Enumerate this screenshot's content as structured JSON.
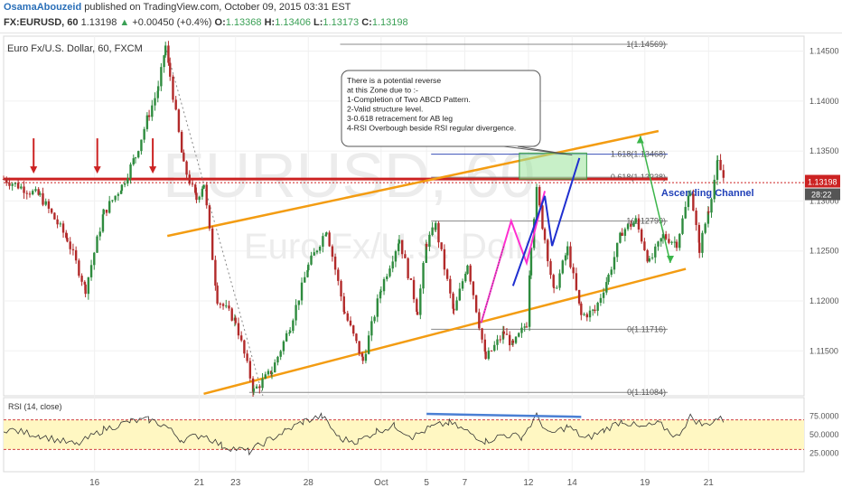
{
  "header": {
    "author": "OsamaAbouzeid",
    "published_text": "published on TradingView.com, October 09, 2015 03:31 EST",
    "symbol": "FX:EURUSD, 60",
    "last": "1.13198",
    "change_arrow": "▲",
    "change": "+0.00450 (+0.4%)",
    "open_label": "O:",
    "open": "1.13368",
    "high_label": "H:",
    "high": "1.13406",
    "low_label": "L:",
    "low": "1.13173",
    "close_label": "C:",
    "close": "1.13198"
  },
  "chart_title": "Euro Fx/U.S. Dollar, 60, FXCM",
  "watermark": {
    "symbol": "EURUSD, 60",
    "name": "Euro Fx/U.S. Dollar"
  },
  "colors": {
    "candle_up": "#2e8b3e",
    "candle_down": "#b22a2a",
    "channel": "#f39c12",
    "resistance": "#cc2222",
    "abcd_pink": "#ff2fd0",
    "abcd_blue": "#1f2fd0",
    "rsi_band": "#fff7c2",
    "rsi_div": "#4a7fd4",
    "fib": "#888888",
    "zone": "#9be39b",
    "green_arrow": "#3bb54a"
  },
  "annotation": {
    "lines": [
      "There is a potential reverse",
      "at this Zone due to   :-",
      "1-Completion of Two ABCD  Pattern.",
      "2-Valid structure level.",
      "3-0.618  retracement for AB leg",
      "4-RSI Overbough beside RSI regular divergence."
    ]
  },
  "channel_label": "Ascending Channel",
  "fib_levels": [
    {
      "label": "1(1.14569)",
      "value": 1.14569
    },
    {
      "label": "1.618(1.13468)",
      "value": 1.13468
    },
    {
      "label": "0.618(1.13238)",
      "value": 1.13238
    },
    {
      "label": "1(1.12799)",
      "value": 1.12799
    },
    {
      "label": "0(1.11716)",
      "value": 1.11716
    },
    {
      "label": "0(1.11084)",
      "value": 1.11084
    }
  ],
  "price_badges": {
    "current": "1.13198",
    "timer": "28:22"
  },
  "rsi": {
    "label": "RSI (14, close)",
    "ticks": [
      "75.0000",
      "50.0000",
      "25.0000"
    ],
    "upper": 70,
    "lower": 30
  },
  "chart_data": {
    "type": "line",
    "title": "Euro Fx/U.S. Dollar, 60, FXCM",
    "xlabel": "",
    "ylabel": "",
    "ylim": [
      1.1105,
      1.1465
    ],
    "y_ticks": [
      "1.14500",
      "1.14000",
      "1.13500",
      "1.13000",
      "1.12500",
      "1.12000",
      "1.11500"
    ],
    "x_ticks": [
      "16",
      "21",
      "23",
      "28",
      "Oct",
      "5",
      "7",
      "12",
      "14",
      "19",
      "21"
    ],
    "price_path_approx": [
      {
        "x": 0.0,
        "y": 1.1322
      },
      {
        "x": 4.0,
        "y": 1.1305
      },
      {
        "x": 7.0,
        "y": 1.1262
      },
      {
        "x": 9.0,
        "y": 1.1212
      },
      {
        "x": 11.0,
        "y": 1.1288
      },
      {
        "x": 13.0,
        "y": 1.1315
      },
      {
        "x": 14.5,
        "y": 1.1345
      },
      {
        "x": 16.0,
        "y": 1.1388
      },
      {
        "x": 17.0,
        "y": 1.1412
      },
      {
        "x": 17.8,
        "y": 1.1455
      },
      {
        "x": 18.3,
        "y": 1.1425
      },
      {
        "x": 19.8,
        "y": 1.1335
      },
      {
        "x": 21.2,
        "y": 1.1302
      },
      {
        "x": 22.0,
        "y": 1.1318
      },
      {
        "x": 23.5,
        "y": 1.1202
      },
      {
        "x": 25.5,
        "y": 1.118
      },
      {
        "x": 27.5,
        "y": 1.111
      },
      {
        "x": 29.5,
        "y": 1.113
      },
      {
        "x": 31.5,
        "y": 1.1175
      },
      {
        "x": 33.5,
        "y": 1.1235
      },
      {
        "x": 35.5,
        "y": 1.1272
      },
      {
        "x": 37.5,
        "y": 1.1188
      },
      {
        "x": 39.5,
        "y": 1.114
      },
      {
        "x": 41.5,
        "y": 1.1213
      },
      {
        "x": 43.5,
        "y": 1.1262
      },
      {
        "x": 45.5,
        "y": 1.119
      },
      {
        "x": 46.5,
        "y": 1.1258
      },
      {
        "x": 47.5,
        "y": 1.1275
      },
      {
        "x": 49.5,
        "y": 1.1188
      },
      {
        "x": 51.0,
        "y": 1.1238
      },
      {
        "x": 53.0,
        "y": 1.1142
      },
      {
        "x": 55.0,
        "y": 1.1168
      },
      {
        "x": 56.0,
        "y": 1.1155
      },
      {
        "x": 57.5,
        "y": 1.1178
      },
      {
        "x": 58.0,
        "y": 1.1258
      },
      {
        "x": 58.6,
        "y": 1.131
      },
      {
        "x": 59.5,
        "y": 1.1262
      },
      {
        "x": 60.5,
        "y": 1.1208
      },
      {
        "x": 62.0,
        "y": 1.1252
      },
      {
        "x": 63.5,
        "y": 1.1185
      },
      {
        "x": 65.0,
        "y": 1.119
      },
      {
        "x": 66.5,
        "y": 1.1225
      },
      {
        "x": 68.0,
        "y": 1.127
      },
      {
        "x": 69.5,
        "y": 1.128
      },
      {
        "x": 71.0,
        "y": 1.1238
      },
      {
        "x": 72.5,
        "y": 1.1265
      },
      {
        "x": 74.0,
        "y": 1.1258
      },
      {
        "x": 75.5,
        "y": 1.1312
      },
      {
        "x": 76.5,
        "y": 1.1252
      },
      {
        "x": 77.5,
        "y": 1.1292
      },
      {
        "x": 78.5,
        "y": 1.1338
      },
      {
        "x": 79.3,
        "y": 1.132
      }
    ],
    "series": [
      {
        "name": "RSI (14, close)",
        "x": [
          0,
          4,
          8,
          11,
          14,
          16,
          17.8,
          19.5,
          22,
          24,
          27,
          29,
          31,
          33,
          35,
          37,
          39,
          41,
          43,
          45,
          47,
          49,
          51,
          53,
          55,
          57,
          58.6,
          60,
          62,
          64,
          66,
          68,
          70,
          72,
          74,
          75.5,
          77,
          78.5,
          79.3
        ],
        "values": [
          58,
          49,
          36,
          57,
          68,
          70,
          62,
          43,
          50,
          35,
          27,
          42,
          55,
          68,
          75,
          44,
          41,
          55,
          62,
          47,
          60,
          66,
          54,
          41,
          50,
          47,
          75,
          50,
          61,
          44,
          56,
          69,
          59,
          65,
          47,
          74,
          62,
          72,
          69
        ]
      }
    ]
  }
}
